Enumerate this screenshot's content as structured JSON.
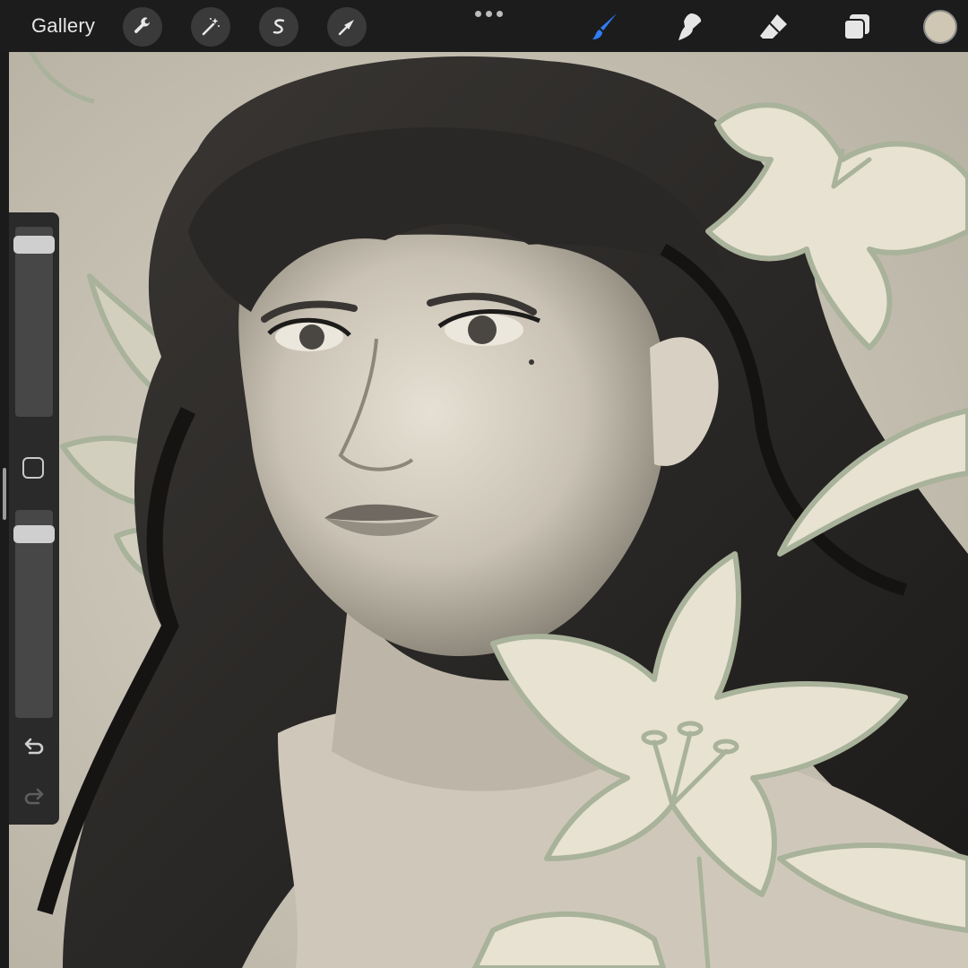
{
  "toolbar": {
    "gallery_label": "Gallery",
    "left_tools": [
      "wrench-icon",
      "magic-wand-icon",
      "selection-icon",
      "transform-arrow-icon"
    ],
    "more_icon": "ellipsis-icon",
    "right_tools": [
      "brush-icon",
      "smudge-icon",
      "eraser-icon",
      "layers-icon"
    ],
    "active_tool": "brush-icon",
    "active_color": "#cfc6b3",
    "accent_color": "#2f7cf6"
  },
  "sidebar": {
    "brush_size": 0.95,
    "opacity": 0.92,
    "icons": [
      "modify-square-icon",
      "undo-icon",
      "redo-icon"
    ]
  },
  "canvas": {
    "background": "#d8d2c3"
  }
}
